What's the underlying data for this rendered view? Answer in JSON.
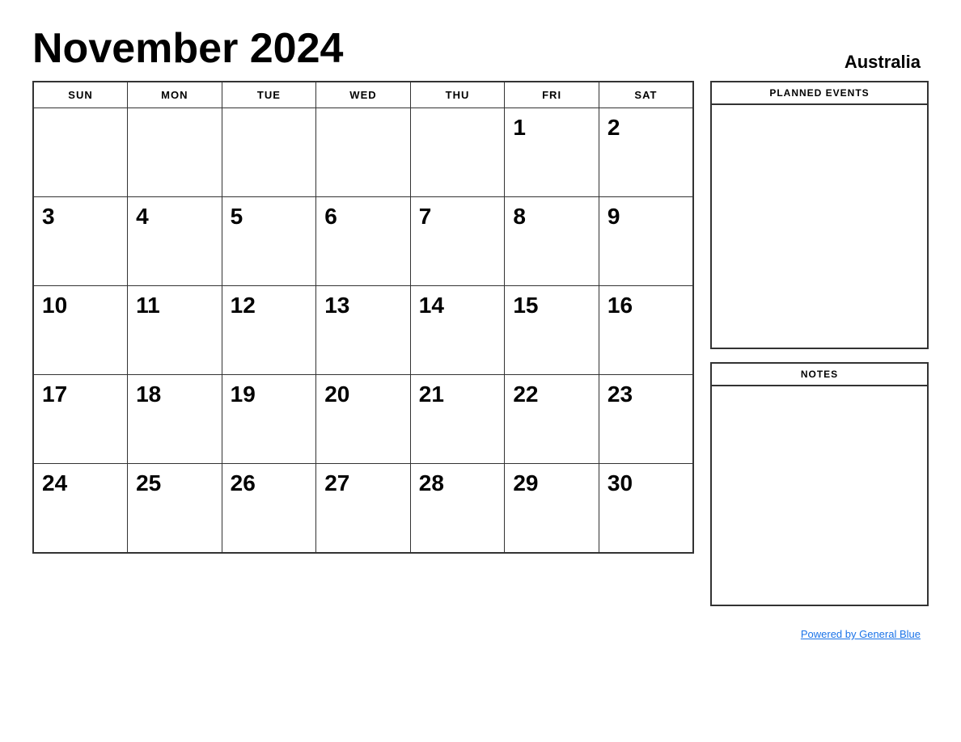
{
  "header": {
    "title": "November 2024",
    "country": "Australia"
  },
  "calendar": {
    "days_of_week": [
      "SUN",
      "MON",
      "TUE",
      "WED",
      "THU",
      "FRI",
      "SAT"
    ],
    "weeks": [
      [
        "",
        "",
        "",
        "",
        "",
        "1",
        "2"
      ],
      [
        "3",
        "4",
        "5",
        "6",
        "7",
        "8",
        "9"
      ],
      [
        "10",
        "11",
        "12",
        "13",
        "14",
        "15",
        "16"
      ],
      [
        "17",
        "18",
        "19",
        "20",
        "21",
        "22",
        "23"
      ],
      [
        "24",
        "25",
        "26",
        "27",
        "28",
        "29",
        "30"
      ]
    ]
  },
  "sidebar": {
    "planned_events_label": "PLANNED EVENTS",
    "notes_label": "NOTES"
  },
  "footer": {
    "powered_by": "Powered by General Blue",
    "link_url": "#"
  }
}
